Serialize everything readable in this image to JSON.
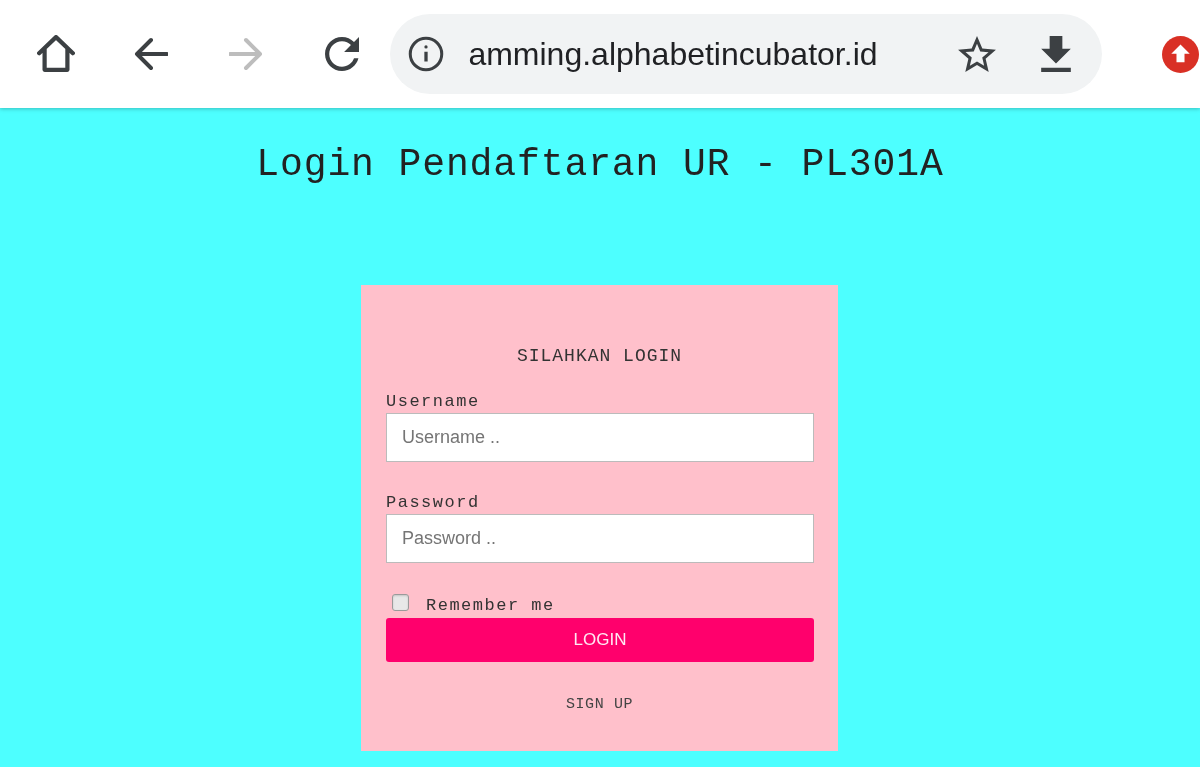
{
  "toolbar": {
    "nav_buttons": [
      {
        "kind": "home",
        "disabled": false
      },
      {
        "kind": "back",
        "disabled": false
      },
      {
        "kind": "forward",
        "disabled": true
      },
      {
        "kind": "reload",
        "disabled": false
      }
    ],
    "url": "amming.alphabetincubator.id"
  },
  "page_title": "Login Pendaftaran UR - PL301A",
  "login_card": {
    "heading": "SILAHKAN LOGIN",
    "fields": [
      {
        "label": "Username",
        "placeholder": "Username .."
      },
      {
        "label": "Password",
        "placeholder": "Password .."
      }
    ],
    "remember_me": {
      "label": "Remember me",
      "checked": false
    },
    "login_button": "LOGIN",
    "sign_up_link": "SIGN UP"
  }
}
